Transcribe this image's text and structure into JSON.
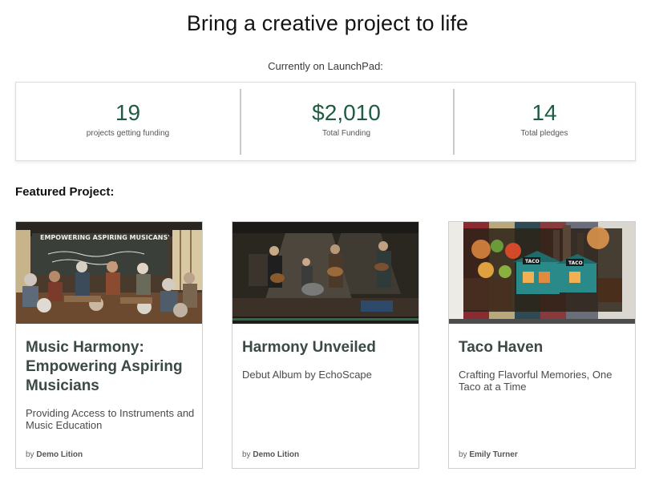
{
  "page": {
    "title": "Bring a creative project to life",
    "stats_caption": "Currently on LaunchPad:"
  },
  "stats": [
    {
      "value": "19",
      "label": "projects getting funding"
    },
    {
      "value": "$2,010",
      "label": "Total Funding"
    },
    {
      "value": "14",
      "label": "Total pledges"
    }
  ],
  "featured_heading": "Featured Project:",
  "projects": [
    {
      "title": "Music Harmony: Empowering Aspiring Musicians",
      "subtitle": "Providing Access to Instruments and Music Education",
      "by_prefix": "by",
      "author": "Demo Lition",
      "image_banner_text": "EMPOWERING ASPIRING MUSICANS'"
    },
    {
      "title": "Harmony Unveiled",
      "subtitle": "Debut Album by EchoScape",
      "by_prefix": "by",
      "author": "Demo Lition"
    },
    {
      "title": "Taco Haven",
      "subtitle": "Crafting Flavorful Memories, One Taco at a Time",
      "by_prefix": "by",
      "author": "Emily Turner",
      "image_signs": [
        "TACO",
        "TACO"
      ]
    }
  ]
}
